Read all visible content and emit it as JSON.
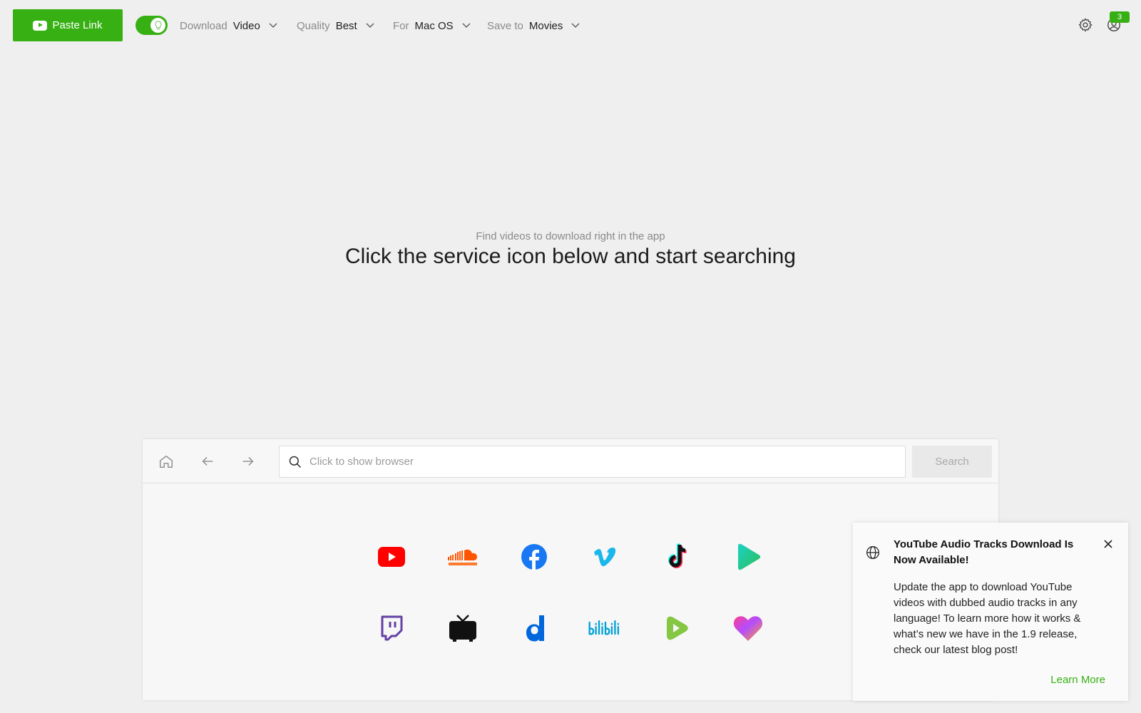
{
  "toolbar": {
    "paste_link_label": "Paste Link",
    "smart_mode_on": true,
    "download": {
      "label": "Download",
      "value": "Video"
    },
    "quality": {
      "label": "Quality",
      "value": "Best"
    },
    "platform": {
      "label": "For",
      "value": "Mac OS"
    },
    "save_to": {
      "label": "Save to",
      "value": "Movies"
    },
    "notifications_count": "3"
  },
  "main": {
    "hint": "Find videos to download right in the app",
    "headline": "Click the service icon below and start searching"
  },
  "browser": {
    "search_placeholder": "Click to show browser",
    "search_button": "Search",
    "services_row1": [
      "YouTube",
      "SoundCloud",
      "Facebook",
      "Vimeo",
      "TikTok",
      "Dailymotion Play"
    ],
    "services_row2": [
      "Twitch",
      "TV",
      "Dailymotion",
      "Bilibili",
      "Rumble",
      "Likee"
    ]
  },
  "notification": {
    "title": "YouTube Audio Tracks Download Is Now Available!",
    "body": "Update the app to download YouTube videos with dubbed audio tracks in any language! To learn more how it works & what’s new we have in the 1.9 release, check our latest blog post!",
    "link": "Learn More"
  },
  "colors": {
    "accent": "#36b012",
    "background": "#efefef",
    "panel": "#f7f7f7"
  }
}
